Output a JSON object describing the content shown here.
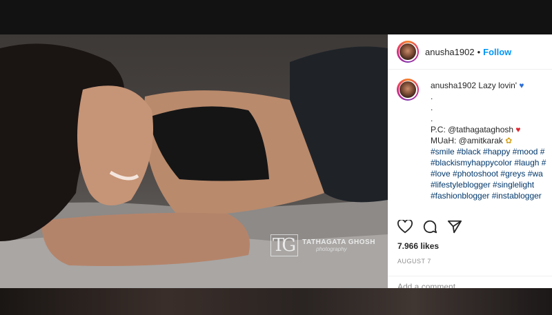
{
  "post": {
    "username": "anusha1902",
    "separator": "•",
    "follow_label": "Follow",
    "caption_lines": [
      "Lazy lovin'",
      ".",
      ".",
      ".",
      "P.C: @tathagataghosh",
      "MUaH: @amitkarak",
      "#smile #black #happy #mood #",
      "#blackismyhappycolor #laugh #",
      "#love #photoshoot #greys #wa",
      "#lifestyleblogger #singlelight",
      "#fashionblogger #instablogger"
    ],
    "likes": "7.966 likes",
    "date": "AUGUST 7",
    "comment_placeholder": "Add a comment..."
  },
  "watermark": {
    "logo": "TG",
    "name": "TATHAGATA GHOSH",
    "sub": "photography"
  },
  "icons": [
    "heart-icon",
    "comment-icon",
    "share-icon"
  ],
  "colors": {
    "follow": "#0095f6",
    "hashtag": "#00376b",
    "secondary_text": "#8e8e8e"
  }
}
